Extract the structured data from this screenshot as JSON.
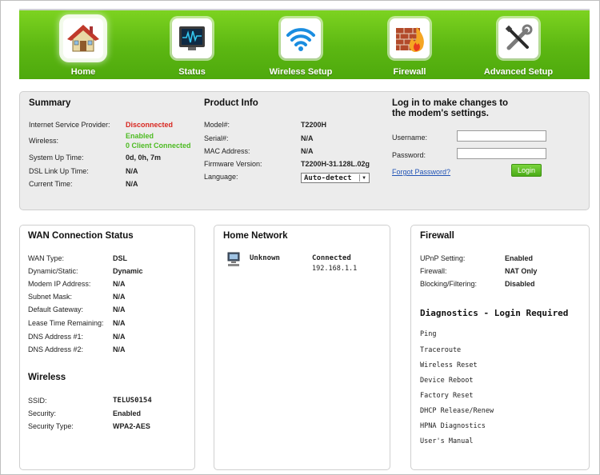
{
  "nav": {
    "items": [
      {
        "label": "Home",
        "icon": "house-icon"
      },
      {
        "label": "Status",
        "icon": "monitor-icon"
      },
      {
        "label": "Wireless Setup",
        "icon": "wifi-icon"
      },
      {
        "label": "Firewall",
        "icon": "firewall-icon"
      },
      {
        "label": "Advanced Setup",
        "icon": "tools-icon"
      }
    ]
  },
  "summary": {
    "title": "Summary",
    "rows": [
      {
        "label": "Internet Service Provider:",
        "value": "Disconnected"
      },
      {
        "label": "Wireless:",
        "value": "Enabled",
        "value2": "0 Client Connected"
      },
      {
        "label": "System Up Time:",
        "value": "0d, 0h, 7m"
      },
      {
        "label": "DSL Link Up Time:",
        "value": "N/A"
      },
      {
        "label": "Current Time:",
        "value": "N/A"
      }
    ]
  },
  "product": {
    "title": "Product Info",
    "rows": [
      {
        "label": "Model#:",
        "value": "T2200H"
      },
      {
        "label": "Serial#:",
        "value": "N/A"
      },
      {
        "label": "MAC Address:",
        "value": "N/A"
      },
      {
        "label": "Firmware Version:",
        "value": "T2200H-31.128L.02g"
      }
    ],
    "language_label": "Language:",
    "language_value": "Auto-detect"
  },
  "login": {
    "title_line1": "Log in to make changes to",
    "title_line2": "the modem's settings.",
    "username_label": "Username:",
    "password_label": "Password:",
    "forgot": "Forgot Password?",
    "button": "Login"
  },
  "wan": {
    "title": "WAN Connection Status",
    "rows": [
      {
        "label": "WAN Type:",
        "value": "DSL"
      },
      {
        "label": "Dynamic/Static:",
        "value": "Dynamic"
      },
      {
        "label": "Modem IP Address:",
        "value": "N/A"
      },
      {
        "label": "Subnet Mask:",
        "value": "N/A"
      },
      {
        "label": "Default Gateway:",
        "value": "N/A"
      },
      {
        "label": "Lease Time Remaining:",
        "value": "N/A"
      },
      {
        "label": "DNS Address #1:",
        "value": "N/A"
      },
      {
        "label": "DNS Address #2:",
        "value": "N/A"
      }
    ]
  },
  "wireless": {
    "title": "Wireless",
    "rows": [
      {
        "label": "SSID:",
        "value": "TELUS0154"
      },
      {
        "label": "Security:",
        "value": "Enabled"
      },
      {
        "label": "Security Type:",
        "value": "WPA2-AES"
      }
    ]
  },
  "home_network": {
    "title": "Home Network",
    "device_name": "Unknown",
    "device_status": "Connected",
    "device_ip": "192.168.1.1"
  },
  "firewall": {
    "title": "Firewall",
    "rows": [
      {
        "label": "UPnP Setting:",
        "value": "Enabled"
      },
      {
        "label": "Firewall:",
        "value": "NAT Only"
      },
      {
        "label": "Blocking/Filtering:",
        "value": "Disabled"
      }
    ]
  },
  "diagnostics": {
    "title": "Diagnostics - Login Required",
    "items": [
      "Ping",
      "Traceroute",
      "Wireless Reset",
      "Device Reboot",
      "Factory Reset",
      "DHCP Release/Renew",
      "HPNA Diagnostics",
      "User's Manual"
    ]
  },
  "colors": {
    "nav_green": "#5cb712",
    "status_red": "#d8261f",
    "status_green": "#4dbb22",
    "link_blue": "#2153b5"
  }
}
